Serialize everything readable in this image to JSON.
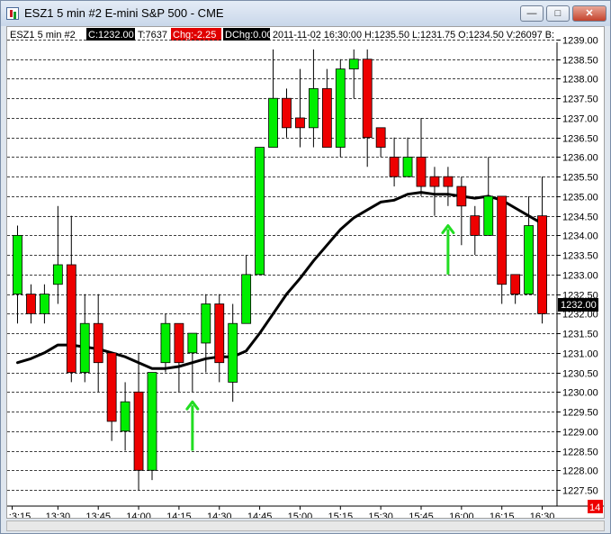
{
  "window": {
    "title": "ESZ1  5 min   #2  E-mini S&P 500 - CME",
    "minimize_label": "—",
    "maximize_label": "□",
    "close_label": "✕"
  },
  "info_bar": {
    "symbol": "ESZ1  5 min   #2",
    "close": "C:1232.00",
    "ticks": "T:7637",
    "change": "Chg:-2.25",
    "dchange": "DChg:0.00",
    "details": "2011-11-02 16:30:00 H:1235.50 L:1231.75 O:1234.50 V:26097 B:"
  },
  "badges": {
    "last_price": "1232.00",
    "corner_count": "14"
  },
  "colors": {
    "up": "#00ee00",
    "down": "#ee0000",
    "grid": "#000000",
    "ma_line": "#000000",
    "arrow": "#22dd22",
    "price_badge_bg": "#000000"
  },
  "chart_data": {
    "type": "candlestick",
    "title": "",
    "xlabel": "",
    "ylabel": "",
    "ylim": [
      1227.25,
      1239.25
    ],
    "y_ticks": [
      1227.5,
      1228.0,
      1228.5,
      1229.0,
      1229.5,
      1230.0,
      1230.5,
      1231.0,
      1231.5,
      1232.0,
      1232.5,
      1233.0,
      1233.5,
      1234.0,
      1234.5,
      1235.0,
      1235.5,
      1236.0,
      1236.5,
      1237.0,
      1237.5,
      1238.0,
      1238.5,
      1239.0
    ],
    "y_tick_labels": [
      "1227.50",
      "1228.00",
      "1228.50",
      "1229.00",
      "1229.50",
      "1230.00",
      "1230.50",
      "1231.00",
      "1231.50",
      "1232.00",
      "1232.50",
      "1233.00",
      "1233.50",
      "1234.00",
      "1234.50",
      "1235.00",
      "1235.50",
      "1236.00",
      "1236.50",
      "1237.00",
      "1237.50",
      "1238.00",
      "1238.50",
      "1239.00"
    ],
    "x_tick_labels": [
      {
        "label": ":3:15",
        "index": -0.4
      },
      {
        "label": "13:30",
        "index": 3
      },
      {
        "label": "13:45",
        "index": 6
      },
      {
        "label": "14:00",
        "index": 9
      },
      {
        "label": "14:15",
        "index": 12
      },
      {
        "label": "14:30",
        "index": 15
      },
      {
        "label": "14:45",
        "index": 18
      },
      {
        "label": "15:00",
        "index": 21
      },
      {
        "label": "15:15",
        "index": 24
      },
      {
        "label": "15:30",
        "index": 27
      },
      {
        "label": "15:45",
        "index": 30
      },
      {
        "label": "16:00",
        "index": 33
      },
      {
        "label": "16:15",
        "index": 36
      },
      {
        "label": "16:30",
        "index": 39
      }
    ],
    "grid": true,
    "candles": [
      {
        "o": 1232.5,
        "h": 1234.25,
        "l": 1231.75,
        "c": 1234.0
      },
      {
        "o": 1232.5,
        "h": 1232.75,
        "l": 1231.75,
        "c": 1232.0
      },
      {
        "o": 1232.0,
        "h": 1232.75,
        "l": 1231.75,
        "c": 1232.5
      },
      {
        "o": 1232.75,
        "h": 1234.75,
        "l": 1232.25,
        "c": 1233.25
      },
      {
        "o": 1233.25,
        "h": 1234.5,
        "l": 1230.25,
        "c": 1230.5
      },
      {
        "o": 1230.5,
        "h": 1232.5,
        "l": 1230.25,
        "c": 1231.75
      },
      {
        "o": 1231.75,
        "h": 1232.5,
        "l": 1230.0,
        "c": 1230.75
      },
      {
        "o": 1231.0,
        "h": 1231.0,
        "l": 1228.75,
        "c": 1229.25
      },
      {
        "o": 1229.0,
        "h": 1230.25,
        "l": 1228.5,
        "c": 1229.75
      },
      {
        "o": 1230.0,
        "h": 1231.0,
        "l": 1227.5,
        "c": 1228.0
      },
      {
        "o": 1228.0,
        "h": 1230.5,
        "l": 1227.75,
        "c": 1230.5
      },
      {
        "o": 1230.75,
        "h": 1232.0,
        "l": 1230.5,
        "c": 1231.75
      },
      {
        "o": 1231.75,
        "h": 1231.75,
        "l": 1230.0,
        "c": 1230.75
      },
      {
        "o": 1231.0,
        "h": 1231.5,
        "l": 1230.0,
        "c": 1231.5
      },
      {
        "o": 1231.25,
        "h": 1232.5,
        "l": 1230.5,
        "c": 1232.25
      },
      {
        "o": 1232.25,
        "h": 1232.5,
        "l": 1230.25,
        "c": 1230.75
      },
      {
        "o": 1230.25,
        "h": 1232.25,
        "l": 1229.75,
        "c": 1231.75
      },
      {
        "o": 1231.75,
        "h": 1233.5,
        "l": 1231.75,
        "c": 1233.0
      },
      {
        "o": 1233.0,
        "h": 1236.25,
        "l": 1233.0,
        "c": 1236.25
      },
      {
        "o": 1236.25,
        "h": 1238.75,
        "l": 1236.25,
        "c": 1237.5
      },
      {
        "o": 1237.5,
        "h": 1237.75,
        "l": 1236.5,
        "c": 1236.75
      },
      {
        "o": 1237.0,
        "h": 1238.25,
        "l": 1236.25,
        "c": 1236.75
      },
      {
        "o": 1236.75,
        "h": 1238.75,
        "l": 1236.25,
        "c": 1237.75
      },
      {
        "o": 1237.75,
        "h": 1238.25,
        "l": 1236.25,
        "c": 1236.25
      },
      {
        "o": 1236.25,
        "h": 1238.5,
        "l": 1236.0,
        "c": 1238.25
      },
      {
        "o": 1238.25,
        "h": 1238.75,
        "l": 1237.5,
        "c": 1238.5
      },
      {
        "o": 1238.5,
        "h": 1238.75,
        "l": 1235.75,
        "c": 1236.5
      },
      {
        "o": 1236.75,
        "h": 1236.75,
        "l": 1236.0,
        "c": 1236.25
      },
      {
        "o": 1236.0,
        "h": 1236.5,
        "l": 1235.25,
        "c": 1235.5
      },
      {
        "o": 1235.5,
        "h": 1236.5,
        "l": 1235.5,
        "c": 1236.0
      },
      {
        "o": 1236.0,
        "h": 1237.0,
        "l": 1235.0,
        "c": 1235.25
      },
      {
        "o": 1235.5,
        "h": 1235.75,
        "l": 1234.5,
        "c": 1235.25
      },
      {
        "o": 1235.5,
        "h": 1235.75,
        "l": 1234.75,
        "c": 1235.25
      },
      {
        "o": 1235.25,
        "h": 1235.5,
        "l": 1233.75,
        "c": 1234.75
      },
      {
        "o": 1234.5,
        "h": 1234.75,
        "l": 1233.5,
        "c": 1234.0
      },
      {
        "o": 1234.0,
        "h": 1236.0,
        "l": 1234.0,
        "c": 1235.0
      },
      {
        "o": 1235.0,
        "h": 1235.0,
        "l": 1232.25,
        "c": 1232.75
      },
      {
        "o": 1233.0,
        "h": 1233.0,
        "l": 1232.25,
        "c": 1232.5
      },
      {
        "o": 1232.5,
        "h": 1235.0,
        "l": 1232.5,
        "c": 1234.25
      },
      {
        "o": 1234.5,
        "h": 1235.5,
        "l": 1231.75,
        "c": 1232.0
      }
    ],
    "moving_average": [
      1230.75,
      1230.85,
      1231.0,
      1231.2,
      1231.2,
      1231.15,
      1231.1,
      1231.0,
      1230.9,
      1230.75,
      1230.6,
      1230.6,
      1230.65,
      1230.75,
      1230.85,
      1230.9,
      1230.9,
      1231.05,
      1231.5,
      1232.0,
      1232.5,
      1232.9,
      1233.35,
      1233.75,
      1234.15,
      1234.45,
      1234.65,
      1234.85,
      1234.9,
      1235.05,
      1235.1,
      1235.05,
      1235.05,
      1235.0,
      1234.95,
      1235.0,
      1234.9,
      1234.7,
      1234.5,
      1234.3
    ],
    "arrows": [
      {
        "index": 13,
        "from": 1228.5,
        "to": 1229.75
      },
      {
        "index": 32,
        "from": 1233.0,
        "to": 1234.25
      }
    ]
  }
}
